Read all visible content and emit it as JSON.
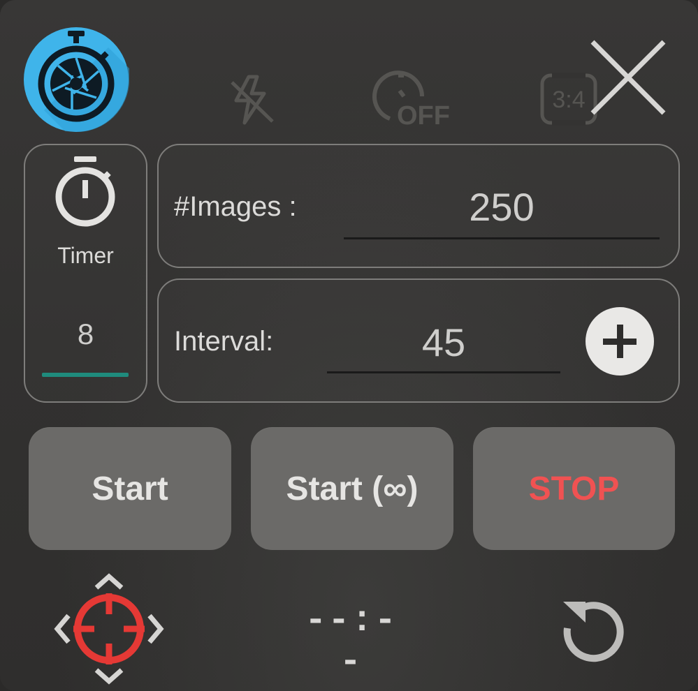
{
  "top_bar": {
    "logo_icon": "stopwatch-aperture-icon",
    "flash_icon": "flash-off-icon",
    "timer_icon": "timer-off-icon",
    "timer_off_text": "OFF",
    "ratio_text": "3:4",
    "close_icon": "close-icon"
  },
  "timer_panel": {
    "icon": "stopwatch-icon",
    "label": "Timer",
    "value": "8"
  },
  "images_panel": {
    "label": "#Images :",
    "value": "250"
  },
  "interval_panel": {
    "label": "Interval:",
    "value": "45",
    "add_icon": "plus-icon"
  },
  "buttons": {
    "start": "Start",
    "start_infinite": "Start (∞)",
    "stop": "STOP"
  },
  "bottom": {
    "target_icon": "crosshair-move-icon",
    "countdown": "--:--",
    "reset_icon": "refresh-icon"
  },
  "colors": {
    "accent_blue": "#3fb4ea",
    "teal_underline": "#1f8b7d",
    "stop_red": "#f05252",
    "target_red": "#e53935"
  }
}
